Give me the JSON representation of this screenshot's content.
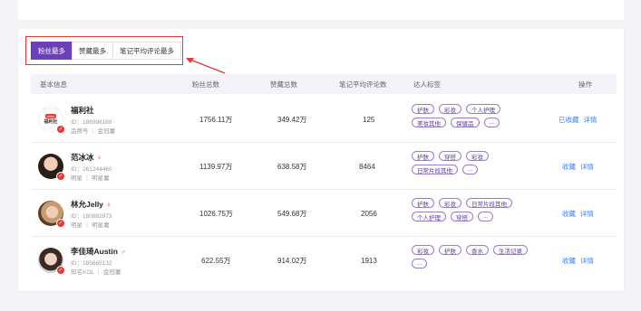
{
  "tabs": [
    {
      "label": "粉丝最多",
      "active": true
    },
    {
      "label": "赞藏最多",
      "active": false
    },
    {
      "label": "笔记平均评论最多",
      "active": false
    }
  ],
  "columns": {
    "basic": "基本信息",
    "fans": "粉丝总数",
    "likes": "赞藏总数",
    "avg_comments": "笔记平均评论数",
    "tags": "达人标签",
    "actions": "操作"
  },
  "rows": [
    {
      "name": "福利社",
      "gender_icon": "",
      "id": "ID：186998189",
      "meta": "品牌号 ｜ 金冠薯",
      "logo_text": "福利社",
      "fans": "1756.11万",
      "likes": "349.42万",
      "avg_comments": "125",
      "tags": [
        "护肤",
        "彩妆",
        "个人护理",
        "美妆其他",
        "保健品",
        "..."
      ],
      "action_collect": "已收藏",
      "action_detail": "详情"
    },
    {
      "name": "范冰冰",
      "gender_icon": "♀",
      "id": "ID：261244460",
      "meta": "明星 ｜ 明星薯",
      "fans": "1139.97万",
      "likes": "638.58万",
      "avg_comments": "8464",
      "tags": [
        "护肤",
        "穿搭",
        "彩妆",
        "日常片段其他",
        "..."
      ],
      "action_collect": "收藏",
      "action_detail": "详情"
    },
    {
      "name": "林允Jelly",
      "gender_icon": "♀",
      "id": "ID：180882973",
      "meta": "明星 ｜ 明星薯",
      "fans": "1026.75万",
      "likes": "549.68万",
      "avg_comments": "2056",
      "tags": [
        "护肤",
        "彩妆",
        "日常片段其他",
        "个人护理",
        "穿搭",
        "..."
      ],
      "action_collect": "收藏",
      "action_detail": "详情"
    },
    {
      "name": "李佳琦Austin",
      "gender_icon": "♂",
      "id": "ID：185685132",
      "meta": "知名KOL ｜ 金冠薯",
      "fans": "622.55万",
      "likes": "914.02万",
      "avg_comments": "1913",
      "tags": [
        "彩妆",
        "护肤",
        "香水",
        "生活记录",
        "..."
      ],
      "action_collect": "收藏",
      "action_detail": "详情"
    }
  ],
  "colors": {
    "accent": "#6b3fb5",
    "highlight": "#e53935",
    "link": "#3b82f6",
    "female": "#e53935",
    "male": "#3b82f6"
  }
}
